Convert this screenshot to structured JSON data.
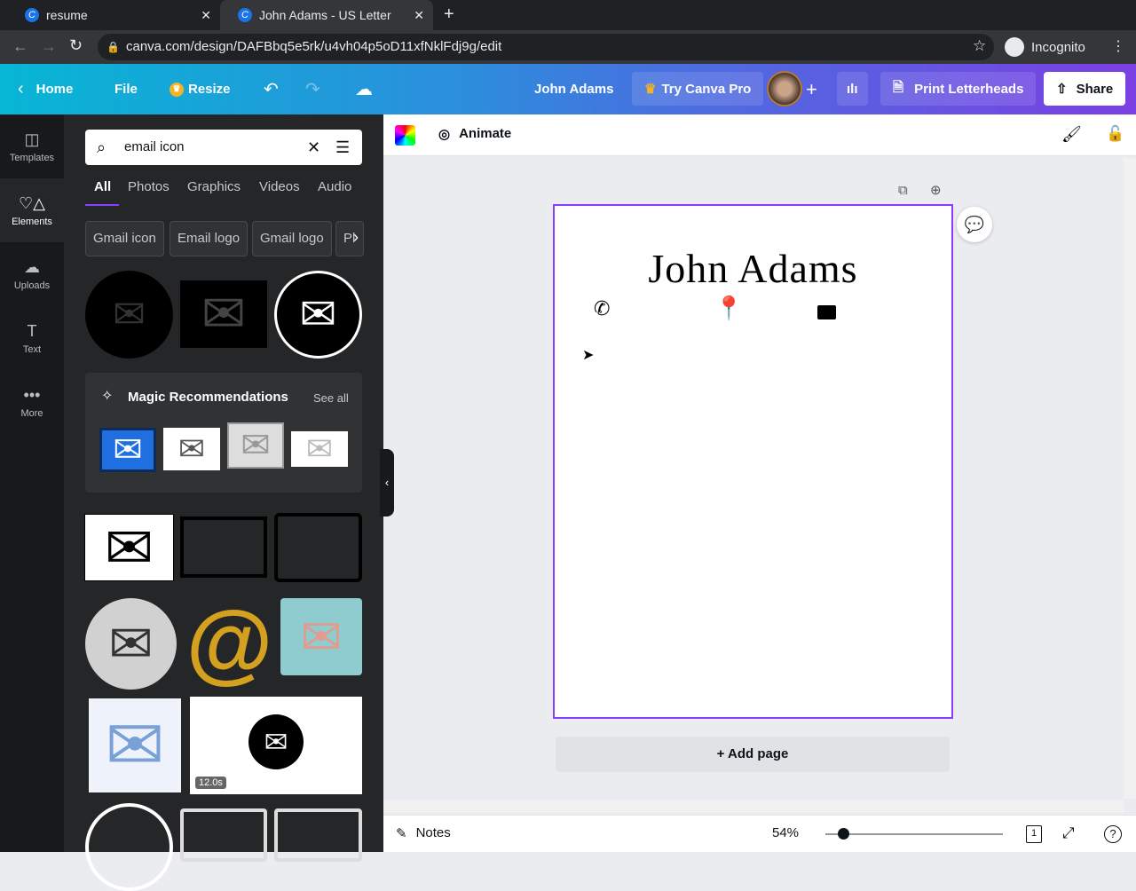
{
  "browser": {
    "tabs": [
      {
        "title": "resume"
      },
      {
        "title": "John Adams - US Letter"
      }
    ],
    "url": "canva.com/design/DAFBbq5e5rk/u4vh04p5oD11xfNklFdj9g/edit",
    "profile": "Incognito"
  },
  "header": {
    "home": "Home",
    "file": "File",
    "resize": "Resize",
    "doc_title": "John Adams",
    "try_pro": "Try Canva Pro",
    "print": "Print Letterheads",
    "share": "Share"
  },
  "rail": [
    {
      "label": "Templates"
    },
    {
      "label": "Elements"
    },
    {
      "label": "Uploads"
    },
    {
      "label": "Text"
    },
    {
      "label": "More"
    }
  ],
  "panel": {
    "search_value": "email icon",
    "filters": [
      "All",
      "Photos",
      "Graphics",
      "Videos",
      "Audio"
    ],
    "chips": [
      "Gmail icon",
      "Email logo",
      "Gmail logo",
      "Pl"
    ],
    "magic_title": "Magic Recommendations",
    "see_all": "See all",
    "video_duration": "12.0s"
  },
  "toolbar": {
    "animate": "Animate"
  },
  "design": {
    "name": "John Adams"
  },
  "add_page": "+ Add page",
  "footer": {
    "notes": "Notes",
    "zoom": "54%",
    "zoom_fraction": 0.1,
    "page_count": "1"
  },
  "colors": {
    "accent": "#8b3dff",
    "rail": "#18191b",
    "panel": "#252627"
  }
}
